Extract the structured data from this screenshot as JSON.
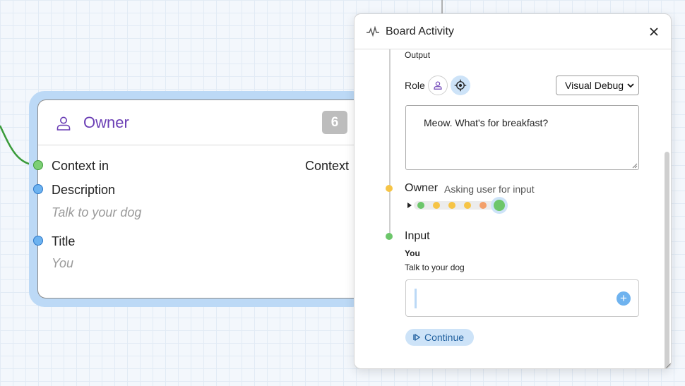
{
  "node": {
    "title": "Owner",
    "badge": "6",
    "ports": {
      "context_in": "Context in",
      "context_out": "Context",
      "description_label": "Description",
      "description_value": "Talk to your dog",
      "title_label": "Title",
      "title_value": "You"
    },
    "icon": "person-icon"
  },
  "panel": {
    "title": "Board Activity",
    "output_label": "Output",
    "role_label": "Role",
    "role_icons": [
      "person-icon",
      "target-icon"
    ],
    "view_select": "Visual Debug",
    "message": "Meow. What's for breakfast?",
    "owner_label": "Owner",
    "owner_status": "Asking user for input",
    "input_label": "Input",
    "input_title": "You",
    "input_description": "Talk to your dog",
    "continue_label": "Continue"
  },
  "colors": {
    "accent_purple": "#6b3fb5",
    "port_green": "#7ccf75",
    "port_blue": "#6cb2f0",
    "dot_yellow": "#f6c445",
    "dot_orange": "#f3a06a",
    "button_blue": "#cde3f8"
  }
}
